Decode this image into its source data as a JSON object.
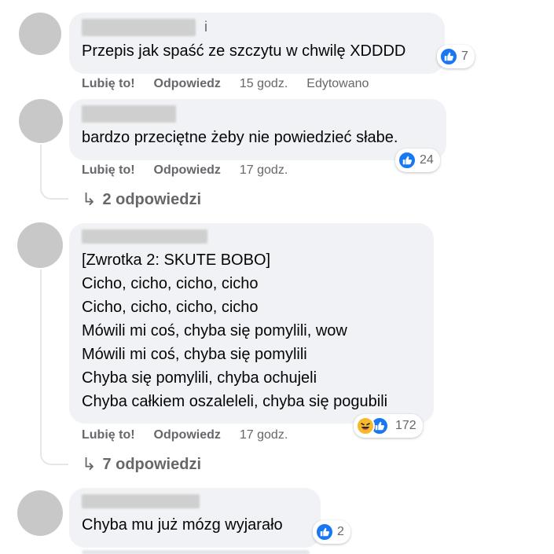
{
  "comments": [
    {
      "author_tail": "i",
      "lines": [
        "Przepis jak spaść ze szczytu w chwilę XDDDD"
      ],
      "like_label": "Lubię to!",
      "reply_label": "Odpowiedz",
      "time": "15 godz.",
      "edited": "Edytowano",
      "reactions": {
        "icons": [
          "like-icon"
        ],
        "count": "7"
      }
    },
    {
      "author_tail": "",
      "lines": [
        "bardzo przeciętne żeby nie powiedzieć słabe."
      ],
      "like_label": "Lubię to!",
      "reply_label": "Odpowiedz",
      "time": "17 godz.",
      "reactions": {
        "icons": [
          "like-icon"
        ],
        "count": "24"
      },
      "replies": "2 odpowiedzi"
    },
    {
      "author_tail": "",
      "lines": [
        "[Zwrotka 2: SKUTE BOBO]",
        "Cicho, cicho, cicho, cicho",
        "Cicho, cicho, cicho, cicho",
        "Mówili mi coś, chyba się pomylili, wow",
        "Mówili mi coś, chyba się pomylili",
        "Chyba się pomylili, chyba ochujeli",
        "Chyba całkiem oszaleleli, chyba się pogubili"
      ],
      "like_label": "Lubię to!",
      "reply_label": "Odpowiedz",
      "time": "17 godz.",
      "reactions": {
        "icons": [
          "haha-icon",
          "like-icon"
        ],
        "count": "172"
      },
      "replies": "7 odpowiedzi"
    },
    {
      "author_tail": "",
      "lines": [
        "Chyba mu już mózg wyjarało"
      ],
      "reactions": {
        "icons": [
          "like-icon"
        ],
        "count": "2"
      }
    }
  ],
  "colors": {
    "bubble": "#f0f2f5",
    "secondary_text": "#65676b",
    "like_blue": "#1877f2",
    "haha_yellow": "#f7b928"
  }
}
